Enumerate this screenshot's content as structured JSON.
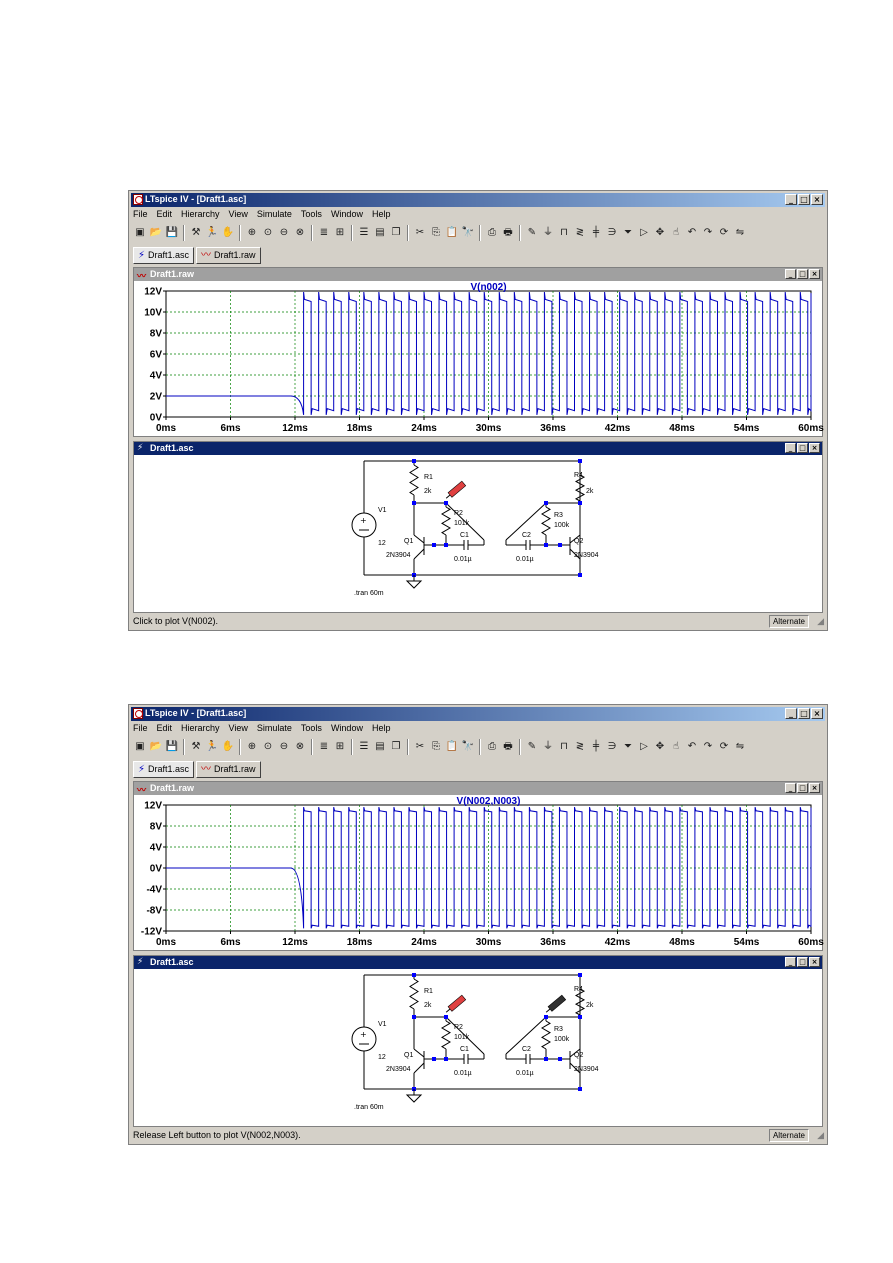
{
  "windows": [
    {
      "title": "LTspice IV - [Draft1.asc]",
      "menus": [
        "File",
        "Edit",
        "Hierarchy",
        "View",
        "Simulate",
        "Tools",
        "Window",
        "Help"
      ],
      "tabs": [
        "Draft1.asc",
        "Draft1.raw"
      ],
      "plot_window_title": "Draft1.raw",
      "schematic_window_title": "Draft1.asc",
      "status_text": "Click to plot V(N002).",
      "status_mode": "Alternate",
      "chart_data": {
        "type": "line",
        "title": "V(n002)",
        "x_unit": "ms",
        "xlim": [
          0,
          60
        ],
        "x_ticks": [
          "0ms",
          "6ms",
          "12ms",
          "18ms",
          "24ms",
          "30ms",
          "36ms",
          "42ms",
          "48ms",
          "54ms",
          "60ms"
        ],
        "ylim": [
          0,
          12
        ],
        "y_ticks": [
          "12V",
          "10V",
          "8V",
          "6V",
          "4V",
          "2V",
          "0V"
        ],
        "grid": true,
        "series": [
          {
            "color": "#0000c0",
            "startup_level": 2.0,
            "startup_end_ms": 12.8,
            "high": 11.8,
            "low": 0.2,
            "oscillation_period_ms": 1.4
          }
        ]
      },
      "schematic": {
        "labels": [
          "R1",
          "2k",
          "R2",
          "101k",
          "C1",
          "0.01µ",
          "Q1",
          "2N3904",
          "V1",
          "12",
          "R4",
          "2k",
          "R3",
          "100k",
          "C2",
          "0.01µ",
          "Q2",
          "2N3904",
          ".tran 60m"
        ]
      }
    },
    {
      "title": "LTspice IV - [Draft1.asc]",
      "menus": [
        "File",
        "Edit",
        "Hierarchy",
        "View",
        "Simulate",
        "Tools",
        "Window",
        "Help"
      ],
      "tabs": [
        "Draft1.asc",
        "Draft1.raw"
      ],
      "plot_window_title": "Draft1.raw",
      "schematic_window_title": "Draft1.asc",
      "status_text": "Release Left button to plot V(N002,N003).",
      "status_mode": "Alternate",
      "chart_data": {
        "type": "line",
        "title": "V(N002,N003)",
        "x_unit": "ms",
        "xlim": [
          0,
          60
        ],
        "x_ticks": [
          "0ms",
          "6ms",
          "12ms",
          "18ms",
          "24ms",
          "30ms",
          "36ms",
          "42ms",
          "48ms",
          "54ms",
          "60ms"
        ],
        "ylim": [
          -12,
          12
        ],
        "y_ticks": [
          "12V",
          "8V",
          "4V",
          "0V",
          "-4V",
          "-8V",
          "-12V"
        ],
        "grid": true,
        "series": [
          {
            "color": "#0000c0",
            "startup_level": 0.0,
            "startup_end_ms": 12.8,
            "high": 11.5,
            "low": -11.5,
            "oscillation_period_ms": 1.4
          }
        ]
      },
      "schematic": {
        "labels": [
          "R1",
          "2k",
          "R2",
          "101k",
          "C1",
          "0.01µ",
          "Q1",
          "2N3904",
          "V1",
          "12",
          "R4",
          "2k",
          "R3",
          "100k",
          "C2",
          "0.01µ",
          "Q2",
          "2N3904",
          ".tran 60m"
        ]
      }
    }
  ],
  "toolbar_icons": [
    "new-schematic-icon",
    "open-icon",
    "save-icon",
    "control-panel-icon",
    "run-icon",
    "halt-icon",
    "zoom-in-icon",
    "zoom-pan-icon",
    "zoom-out-icon",
    "zoom-fit-icon",
    "autorange-icon",
    "reset-icon",
    "tile-horizontal-icon",
    "tile-vertical-icon",
    "cascade-icon",
    "cut-icon",
    "copy-icon",
    "paste-icon",
    "find-icon",
    "print-setup-icon",
    "print-icon",
    "wire-icon",
    "ground-icon",
    "label-net-icon",
    "resistor-icon",
    "capacitor-icon",
    "inductor-icon",
    "diode-icon",
    "component-icon",
    "move-icon",
    "drag-icon",
    "undo-icon",
    "redo-icon",
    "rotate-icon",
    "mirror-icon"
  ]
}
